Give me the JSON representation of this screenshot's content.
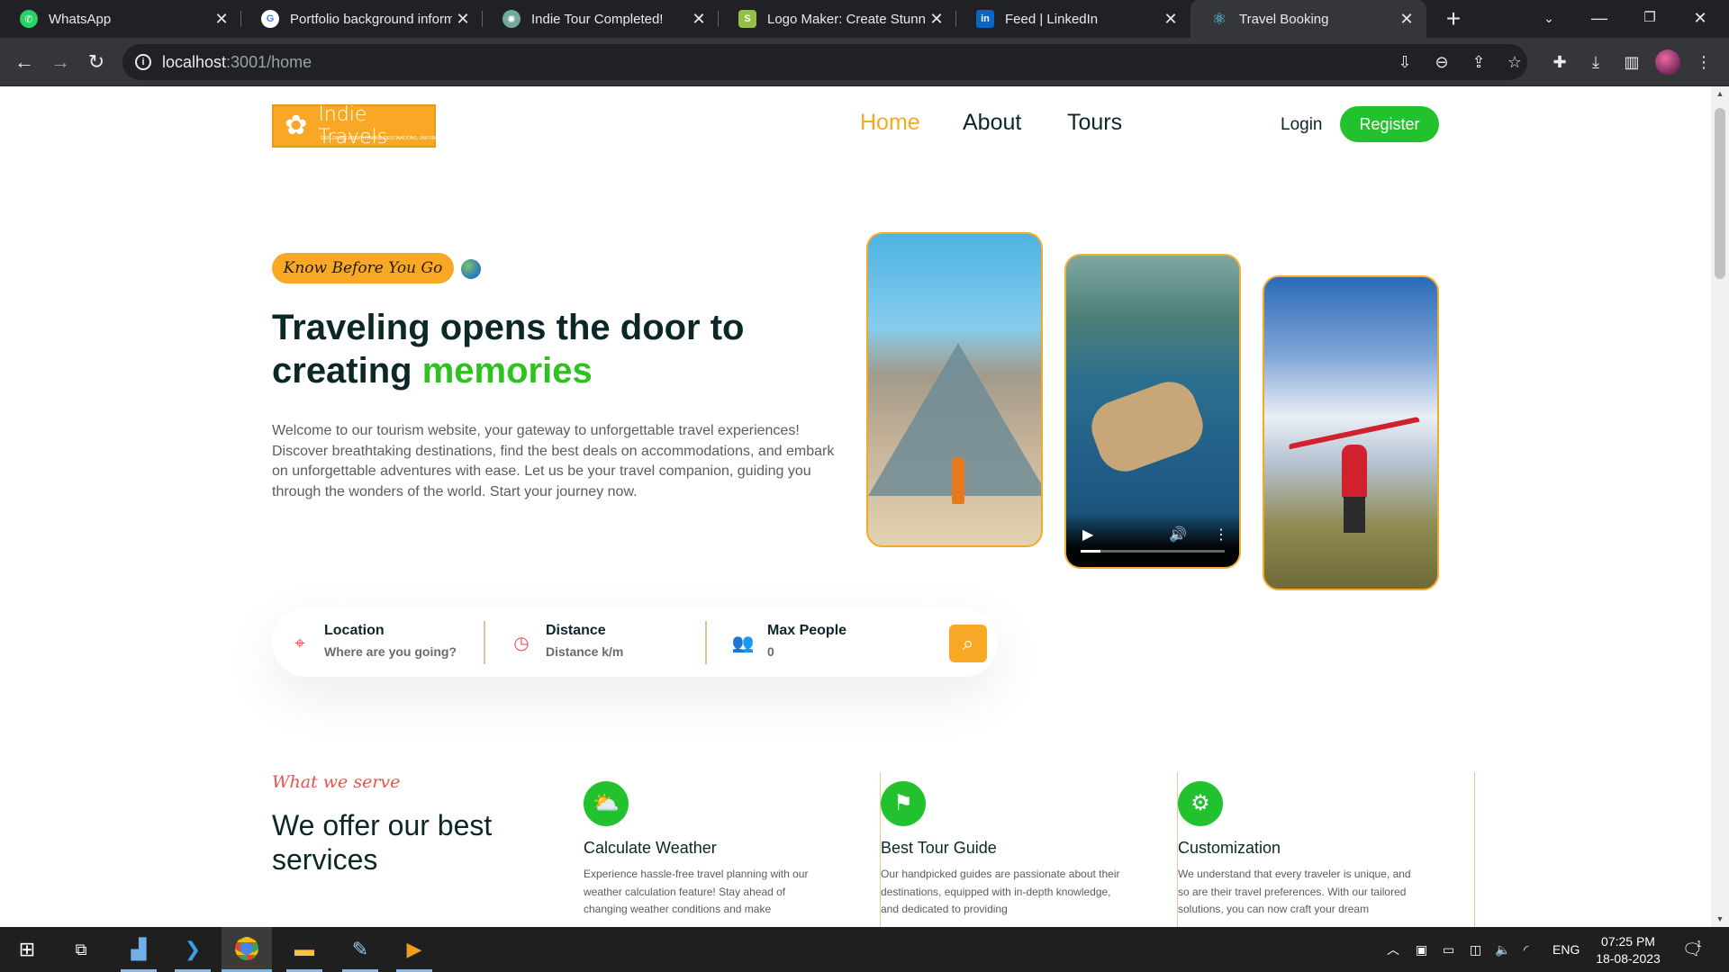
{
  "browser": {
    "tabs": [
      {
        "title": "WhatsApp",
        "favicon": "whatsapp-icon",
        "color": "#25d366"
      },
      {
        "title": "Portfolio background inform",
        "favicon": "google-icon",
        "color": "#4285f4"
      },
      {
        "title": "Indie Tour Completed!",
        "favicon": "chatgpt-icon",
        "color": "#74aa9c"
      },
      {
        "title": "Logo Maker: Create Stunnin",
        "favicon": "shopify-icon",
        "color": "#95bf47"
      },
      {
        "title": "Feed | LinkedIn",
        "favicon": "linkedin-icon",
        "color": "#0a66c2"
      },
      {
        "title": "Travel Booking",
        "favicon": "react-icon",
        "color": "#61dafb"
      }
    ],
    "url_host": "localhost",
    "url_rest": ":3001/home"
  },
  "site": {
    "logo_text": "Indie Travels",
    "logo_tagline": "EXPLORING BREATHTAKING DESTINATIONS, UNFORGETTABLE MEMORIES",
    "nav": [
      "Home",
      "About",
      "Tours"
    ],
    "login": "Login",
    "register": "Register"
  },
  "hero": {
    "badge": "Know Before You Go",
    "title_part1": "Traveling opens the door to creating ",
    "title_highlight": "memories",
    "description": "Welcome to our tourism website, your gateway to unforgettable travel experiences! Discover breathtaking destinations, find the best deals on accommodations, and embark on unforgettable adventures with ease. Let us be your travel companion, guiding you through the wonders of the world. Start your journey now.",
    "video_progress": 0.14
  },
  "search": {
    "location_label": "Location",
    "location_placeholder": "Where are you going?",
    "distance_label": "Distance",
    "distance_placeholder": "Distance k/m",
    "people_label": "Max People",
    "people_placeholder": "0"
  },
  "services": {
    "subtitle": "What we serve",
    "title": "We offer our best services",
    "cards": [
      {
        "title": "Calculate Weather",
        "icon": "weather-icon",
        "desc": "Experience hassle-free travel planning with our weather calculation feature! Stay ahead of changing weather conditions and make"
      },
      {
        "title": "Best Tour Guide",
        "icon": "guide-icon",
        "desc": "Our handpicked guides are passionate about their destinations, equipped with in-depth knowledge, and dedicated to providing"
      },
      {
        "title": "Customization",
        "icon": "customize-icon",
        "desc": "We understand that every traveler is unique, and so are their travel preferences. With our tailored solutions, you can now craft your dream"
      }
    ]
  },
  "taskbar": {
    "lang": "ENG",
    "time": "07:25 PM",
    "date": "18-08-2023",
    "notif_count": "1"
  },
  "colors": {
    "accent": "#f9a826",
    "green": "#22c22e",
    "heading": "#0b2727",
    "secondary": "#e5534b"
  }
}
